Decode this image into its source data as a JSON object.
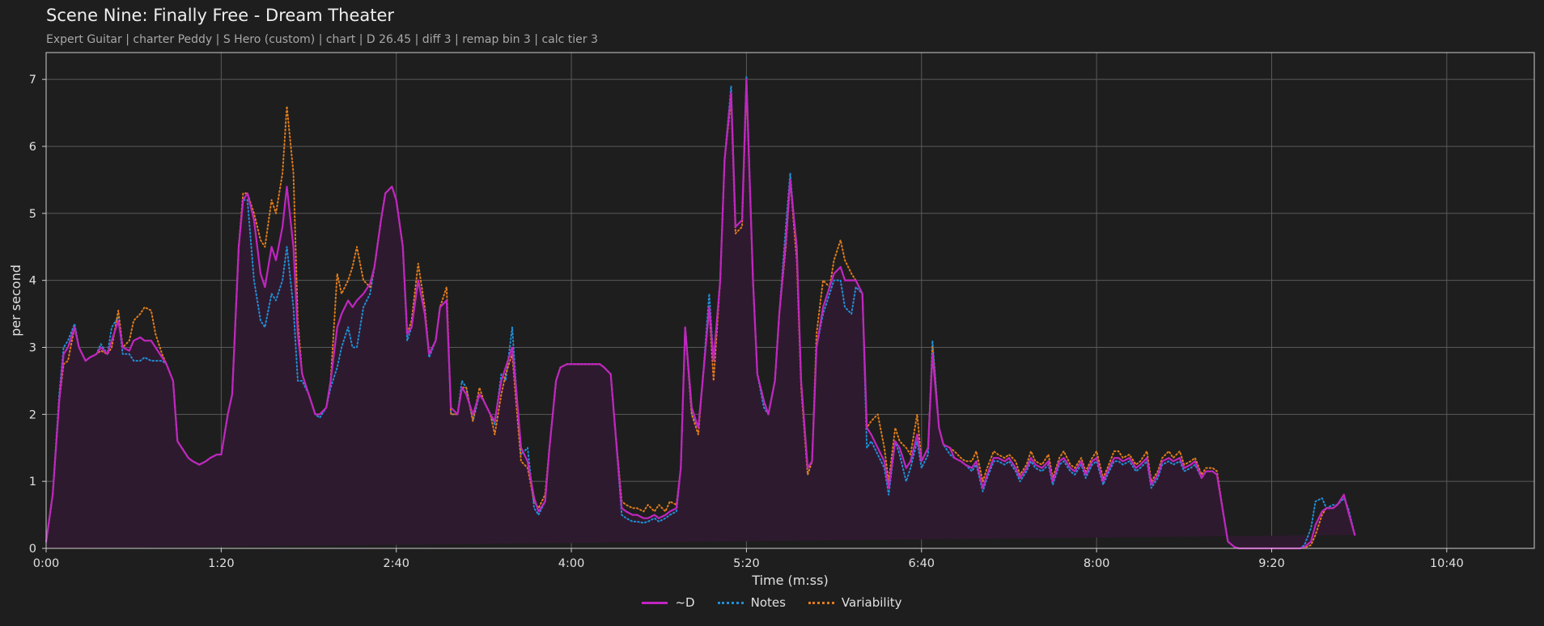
{
  "title": "Scene Nine: Finally Free - Dream Theater",
  "subtitle": "Expert Guitar  |  charter Peddy  |  S Hero (custom)  |  chart  |  D 26.45  |  diff 3  |  remap bin 3  |  calc tier 3",
  "colors": {
    "background": "#1e1e1e",
    "grid": "#5a5a5a",
    "d": "#c026c0",
    "notes": "#1f8fd6",
    "variability": "#e07b1a",
    "fill": "#2e1a2e"
  },
  "chart_data": {
    "type": "line",
    "xlabel": "Time (m:ss)",
    "ylabel": "per second",
    "xlim": [
      0,
      680
    ],
    "ylim": [
      0,
      7.4
    ],
    "x_ticks": [
      0,
      80,
      160,
      240,
      320,
      400,
      480,
      560,
      640
    ],
    "x_tick_labels": [
      "0:00",
      "1:20",
      "2:40",
      "4:00",
      "5:20",
      "6:40",
      "8:00",
      "9:20",
      "10:40"
    ],
    "y_ticks": [
      0,
      1,
      2,
      3,
      4,
      5,
      6,
      7
    ],
    "y_tick_labels": [
      "0",
      "1",
      "2",
      "3",
      "4",
      "5",
      "6",
      "7"
    ],
    "grid": true,
    "legend_position": "bottom-center",
    "x": [
      0,
      3,
      6,
      8,
      10,
      13,
      15,
      18,
      20,
      23,
      25,
      28,
      30,
      33,
      35,
      38,
      40,
      43,
      45,
      48,
      50,
      53,
      55,
      58,
      60,
      63,
      65,
      67,
      70,
      73,
      75,
      78,
      80,
      83,
      85,
      88,
      90,
      92,
      95,
      98,
      100,
      103,
      105,
      108,
      110,
      113,
      115,
      117,
      120,
      123,
      125,
      128,
      130,
      133,
      135,
      138,
      140,
      142,
      145,
      148,
      150,
      153,
      155,
      158,
      160,
      163,
      165,
      167,
      170,
      173,
      175,
      178,
      180,
      183,
      185,
      188,
      190,
      192,
      195,
      198,
      200,
      203,
      205,
      208,
      210,
      213,
      215,
      217,
      220,
      223,
      225,
      228,
      230,
      233,
      235,
      238,
      240,
      243,
      245,
      247,
      250,
      253,
      255,
      258,
      260,
      263,
      265,
      268,
      270,
      273,
      275,
      278,
      280,
      283,
      285,
      288,
      290,
      292,
      295,
      298,
      300,
      303,
      305,
      308,
      310,
      313,
      315,
      318,
      320,
      323,
      325,
      328,
      330,
      333,
      335,
      338,
      340,
      343,
      345,
      348,
      350,
      352,
      355,
      358,
      360,
      363,
      365,
      368,
      370,
      373,
      375,
      377,
      380,
      383,
      385,
      388,
      390,
      393,
      395,
      398,
      400,
      403,
      405,
      408,
      410,
      413,
      415,
      418,
      420,
      423,
      425,
      428,
      430,
      433,
      435,
      438,
      440,
      443,
      445,
      448,
      450,
      452,
      455,
      458,
      460,
      463,
      465,
      468,
      470,
      473,
      475,
      478,
      480,
      483,
      485,
      488,
      490,
      492,
      495,
      498,
      500,
      503,
      505,
      508,
      510,
      513,
      515,
      518,
      520,
      523,
      525,
      528,
      530,
      533,
      535,
      538,
      540,
      543,
      545,
      548,
      550,
      553,
      555,
      558,
      560,
      563,
      565,
      568,
      570,
      573,
      575,
      578,
      580,
      583,
      585,
      588,
      590,
      593,
      595,
      598,
      600,
      602,
      605,
      608,
      610,
      613,
      615,
      618,
      620,
      623,
      625,
      628,
      630,
      633,
      635,
      638,
      640,
      643,
      645,
      648,
      650,
      653,
      655,
      658,
      660,
      663,
      665,
      668,
      670,
      673,
      675,
      678,
      680
    ],
    "series": [
      {
        "name": "~D",
        "values": [
          0.1,
          0.8,
          2.2,
          2.9,
          3.0,
          3.3,
          3.0,
          2.8,
          2.85,
          2.9,
          3.0,
          2.9,
          3.1,
          3.4,
          3.0,
          2.95,
          3.1,
          3.15,
          3.1,
          3.1,
          3.0,
          2.85,
          2.75,
          2.5,
          1.6,
          1.45,
          1.35,
          1.3,
          1.25,
          1.3,
          1.35,
          1.4,
          1.4,
          2.0,
          2.3,
          4.5,
          5.2,
          5.3,
          4.9,
          4.1,
          3.9,
          4.5,
          4.3,
          4.8,
          5.4,
          4.5,
          3.2,
          2.6,
          2.3,
          2.0,
          2.0,
          2.1,
          2.5,
          3.3,
          3.5,
          3.7,
          3.6,
          3.7,
          3.8,
          3.95,
          4.2,
          4.9,
          5.3,
          5.4,
          5.2,
          4.5,
          3.2,
          3.3,
          4.0,
          3.5,
          2.9,
          3.1,
          3.6,
          3.7,
          2.1,
          2.0,
          2.4,
          2.3,
          2.0,
          2.3,
          2.2,
          2.0,
          1.9,
          2.5,
          2.7,
          3.0,
          2.3,
          1.5,
          1.3,
          0.75,
          0.55,
          0.7,
          1.5,
          2.5,
          2.7,
          2.75,
          2.75,
          2.75,
          2.75,
          2.75,
          2.75,
          2.75,
          2.7,
          2.6,
          1.8,
          0.6,
          0.55,
          0.5,
          0.5,
          0.45,
          0.45,
          0.5,
          0.45,
          0.5,
          0.55,
          0.6,
          1.2,
          3.3,
          2.1,
          1.8,
          2.5,
          3.6,
          2.8,
          4.0,
          5.8,
          6.8,
          4.8,
          4.9,
          7.0,
          4.0,
          2.6,
          2.2,
          2.0,
          2.5,
          3.5,
          4.6,
          5.5,
          4.5,
          2.5,
          1.2,
          1.3,
          3.0,
          3.6,
          3.9,
          4.1,
          4.2,
          4.0,
          4.0,
          4.0,
          3.8,
          1.8,
          1.7,
          1.5,
          1.3,
          0.9,
          1.6,
          1.5,
          1.2,
          1.3,
          1.7,
          1.3,
          1.5,
          2.9,
          1.8,
          1.55,
          1.5,
          1.35,
          1.3,
          1.25,
          1.2,
          1.3,
          0.9,
          1.1,
          1.35,
          1.35,
          1.3,
          1.35,
          1.2,
          1.05,
          1.2,
          1.35,
          1.25,
          1.2,
          1.3,
          1.0,
          1.3,
          1.35,
          1.2,
          1.15,
          1.3,
          1.1,
          1.3,
          1.35,
          1.0,
          1.15,
          1.35,
          1.35,
          1.3,
          1.35,
          1.2,
          1.25,
          1.35,
          0.95,
          1.1,
          1.3,
          1.35,
          1.3,
          1.35,
          1.2,
          1.25,
          1.3,
          1.05,
          1.15,
          1.15,
          1.1,
          0.5,
          0.1,
          0.02,
          0,
          0,
          0,
          0,
          0,
          0,
          0,
          0,
          0,
          0,
          0,
          0,
          0.02,
          0.1,
          0.35,
          0.55,
          0.6,
          0.6,
          0.65,
          0.8,
          0.55,
          0.2
        ]
      },
      {
        "name": "Notes",
        "values": [
          0.1,
          0.8,
          2.3,
          3.0,
          3.1,
          3.35,
          3.0,
          2.8,
          2.85,
          2.9,
          3.05,
          2.9,
          3.3,
          3.45,
          2.9,
          2.9,
          2.8,
          2.8,
          2.85,
          2.8,
          2.8,
          2.8,
          2.75,
          2.5,
          1.6,
          1.45,
          1.35,
          1.3,
          1.25,
          1.3,
          1.35,
          1.4,
          1.4,
          2.0,
          2.3,
          4.5,
          5.2,
          5.2,
          4.0,
          3.4,
          3.3,
          3.8,
          3.7,
          4.0,
          4.5,
          3.6,
          2.5,
          2.5,
          2.3,
          2.0,
          1.95,
          2.1,
          2.4,
          2.7,
          3.0,
          3.3,
          3.0,
          3.0,
          3.6,
          3.8,
          4.2,
          4.9,
          5.3,
          5.4,
          5.2,
          4.5,
          3.1,
          3.3,
          4.0,
          3.5,
          2.85,
          3.1,
          3.6,
          3.7,
          2.0,
          2.0,
          2.5,
          2.4,
          1.9,
          2.3,
          2.2,
          2.0,
          1.85,
          2.6,
          2.5,
          3.3,
          2.3,
          1.4,
          1.5,
          0.6,
          0.5,
          0.7,
          1.5,
          2.5,
          2.7,
          2.75,
          2.75,
          2.75,
          2.75,
          2.75,
          2.75,
          2.75,
          2.7,
          2.6,
          1.8,
          0.5,
          0.45,
          0.4,
          0.4,
          0.38,
          0.4,
          0.45,
          0.4,
          0.45,
          0.5,
          0.55,
          1.2,
          3.3,
          2.0,
          1.8,
          2.5,
          3.8,
          2.8,
          4.0,
          5.8,
          6.9,
          4.8,
          4.9,
          7.05,
          4.0,
          2.6,
          2.1,
          2.0,
          2.5,
          3.5,
          4.8,
          5.6,
          4.4,
          2.5,
          1.1,
          1.3,
          3.0,
          3.5,
          3.8,
          4.0,
          4.0,
          3.6,
          3.5,
          3.9,
          3.8,
          1.5,
          1.6,
          1.4,
          1.2,
          0.8,
          1.6,
          1.4,
          1.0,
          1.2,
          1.6,
          1.2,
          1.4,
          3.1,
          1.8,
          1.55,
          1.4,
          1.35,
          1.3,
          1.25,
          1.15,
          1.25,
          0.85,
          1.05,
          1.3,
          1.3,
          1.25,
          1.3,
          1.15,
          1.0,
          1.15,
          1.3,
          1.2,
          1.15,
          1.25,
          0.95,
          1.25,
          1.3,
          1.15,
          1.1,
          1.25,
          1.05,
          1.25,
          1.3,
          0.95,
          1.1,
          1.3,
          1.3,
          1.25,
          1.3,
          1.15,
          1.2,
          1.3,
          0.9,
          1.05,
          1.25,
          1.3,
          1.25,
          1.3,
          1.15,
          1.2,
          1.25,
          1.05,
          1.15,
          1.15,
          1.1,
          0.5,
          0.1,
          0.02,
          0,
          0,
          0,
          0,
          0,
          0,
          0,
          0,
          0,
          0,
          0,
          0,
          0.05,
          0.3,
          0.7,
          0.75,
          0.6,
          0.65,
          0.65,
          0.75,
          0.6,
          0.2
        ]
      },
      {
        "name": "Variability",
        "values": [
          0.1,
          0.8,
          2.2,
          2.75,
          2.8,
          3.3,
          3.0,
          2.8,
          2.85,
          2.9,
          2.95,
          2.9,
          3.0,
          3.55,
          3.0,
          3.1,
          3.4,
          3.5,
          3.6,
          3.55,
          3.2,
          2.9,
          2.75,
          2.5,
          1.6,
          1.45,
          1.35,
          1.3,
          1.25,
          1.3,
          1.35,
          1.4,
          1.4,
          2.0,
          2.3,
          4.5,
          5.3,
          5.3,
          5.0,
          4.6,
          4.5,
          5.2,
          5.0,
          5.6,
          6.6,
          5.6,
          3.4,
          2.6,
          2.3,
          2.0,
          2.0,
          2.1,
          2.5,
          4.1,
          3.8,
          4.0,
          4.2,
          4.5,
          4.0,
          3.9,
          4.2,
          4.9,
          5.3,
          5.4,
          5.2,
          4.5,
          3.2,
          3.4,
          4.25,
          3.6,
          2.9,
          3.1,
          3.6,
          3.9,
          2.0,
          2.0,
          2.4,
          2.4,
          1.9,
          2.4,
          2.2,
          2.0,
          1.7,
          2.3,
          2.6,
          2.9,
          2.1,
          1.3,
          1.2,
          0.7,
          0.6,
          0.8,
          1.5,
          2.5,
          2.7,
          2.75,
          2.75,
          2.75,
          2.75,
          2.75,
          2.75,
          2.75,
          2.7,
          2.6,
          1.8,
          0.7,
          0.65,
          0.6,
          0.6,
          0.55,
          0.65,
          0.55,
          0.65,
          0.55,
          0.7,
          0.65,
          1.2,
          3.3,
          2.0,
          1.7,
          2.5,
          3.6,
          2.5,
          4.0,
          5.8,
          6.7,
          4.7,
          4.8,
          6.9,
          4.0,
          2.6,
          2.2,
          2.0,
          2.5,
          3.5,
          4.5,
          5.5,
          4.3,
          2.4,
          1.1,
          1.3,
          3.2,
          4.0,
          3.9,
          4.3,
          4.6,
          4.3,
          4.1,
          4.0,
          3.8,
          1.8,
          1.9,
          2.0,
          1.5,
          1.0,
          1.8,
          1.6,
          1.5,
          1.4,
          2.0,
          1.3,
          1.5,
          3.0,
          1.8,
          1.55,
          1.5,
          1.45,
          1.35,
          1.3,
          1.3,
          1.45,
          1.0,
          1.2,
          1.45,
          1.4,
          1.35,
          1.4,
          1.3,
          1.1,
          1.25,
          1.45,
          1.3,
          1.25,
          1.4,
          1.05,
          1.35,
          1.45,
          1.25,
          1.2,
          1.35,
          1.15,
          1.35,
          1.45,
          1.05,
          1.2,
          1.45,
          1.45,
          1.35,
          1.4,
          1.25,
          1.3,
          1.45,
          1.0,
          1.15,
          1.35,
          1.45,
          1.35,
          1.45,
          1.25,
          1.3,
          1.35,
          1.1,
          1.2,
          1.2,
          1.15,
          0.5,
          0.1,
          0.02,
          0,
          0,
          0,
          0,
          0,
          0,
          0,
          0,
          0,
          0,
          0,
          0,
          0.01,
          0.05,
          0.2,
          0.5,
          0.6,
          0.6,
          0.65,
          0.8,
          0.55,
          0.2
        ]
      }
    ]
  }
}
